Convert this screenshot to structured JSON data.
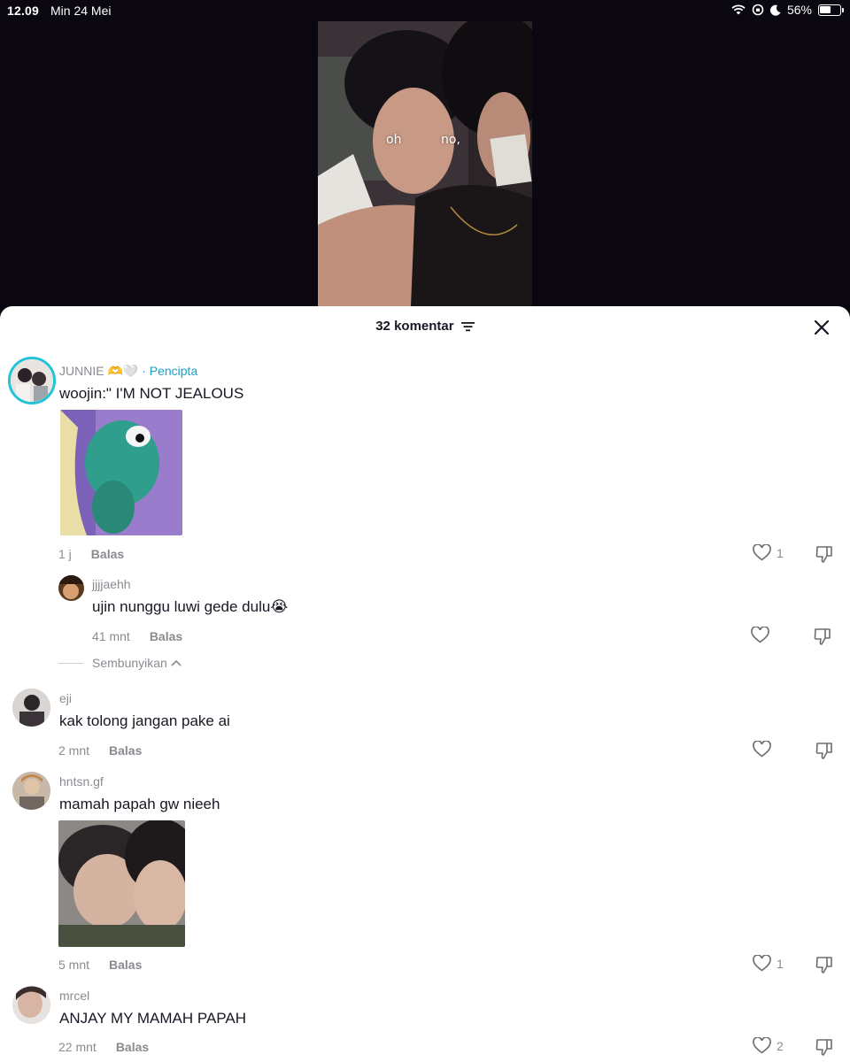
{
  "status": {
    "time": "12.09",
    "date": "Min 24 Mei",
    "battery": "56%"
  },
  "video": {
    "caption_left": "oh",
    "caption_right": "no,"
  },
  "sheet": {
    "title": "32 komentar"
  },
  "comments": [
    {
      "user": "JUNNIE 🫶🤍",
      "badge": "· Pencipta",
      "text": "woojin:\" I'M NOT JEALOUS",
      "time": "1 j",
      "reply": "Balas",
      "likes": "1",
      "replies": [
        {
          "user": "jjjjaehh",
          "text": "ujin nunggu luwi gede dulu😭",
          "time": "41 mnt",
          "reply": "Balas",
          "likes": ""
        }
      ],
      "hide_label": "Sembunyikan"
    },
    {
      "user": "eji",
      "text": "kak tolong jangan pake ai",
      "time": "2 mnt",
      "reply": "Balas",
      "likes": ""
    },
    {
      "user": "hntsn.gf",
      "text": "mamah papah gw nieeh",
      "time": "5 mnt",
      "reply": "Balas",
      "likes": "1"
    },
    {
      "user": "mrcel",
      "text": "ANJAY MY MAMAH PAPAH",
      "time": "22 mnt",
      "reply": "Balas",
      "likes": "2"
    }
  ]
}
